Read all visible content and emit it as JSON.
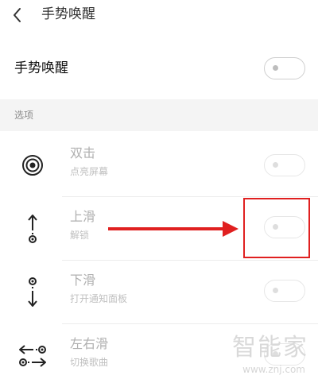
{
  "header": {
    "title": "手势唤醒"
  },
  "master": {
    "label": "手势唤醒",
    "enabled": false
  },
  "section": {
    "label": "选项"
  },
  "options": [
    {
      "title": "双击",
      "subtitle": "点亮屏幕",
      "icon": "double-tap-icon",
      "enabled": false
    },
    {
      "title": "上滑",
      "subtitle": "解锁",
      "icon": "swipe-up-icon",
      "enabled": false
    },
    {
      "title": "下滑",
      "subtitle": "打开通知面板",
      "icon": "swipe-down-icon",
      "enabled": false
    },
    {
      "title": "左右滑",
      "subtitle": "切换歌曲",
      "icon": "swipe-left-right-icon",
      "enabled": false
    }
  ],
  "annotation": {
    "color": "#e02020"
  },
  "watermark": {
    "brand": "智能家",
    "url": "www.znj.com"
  },
  "colors": {
    "background": "#ffffff",
    "section_band": "#f4f4f4",
    "disabled_text": "#b0b0b0"
  }
}
